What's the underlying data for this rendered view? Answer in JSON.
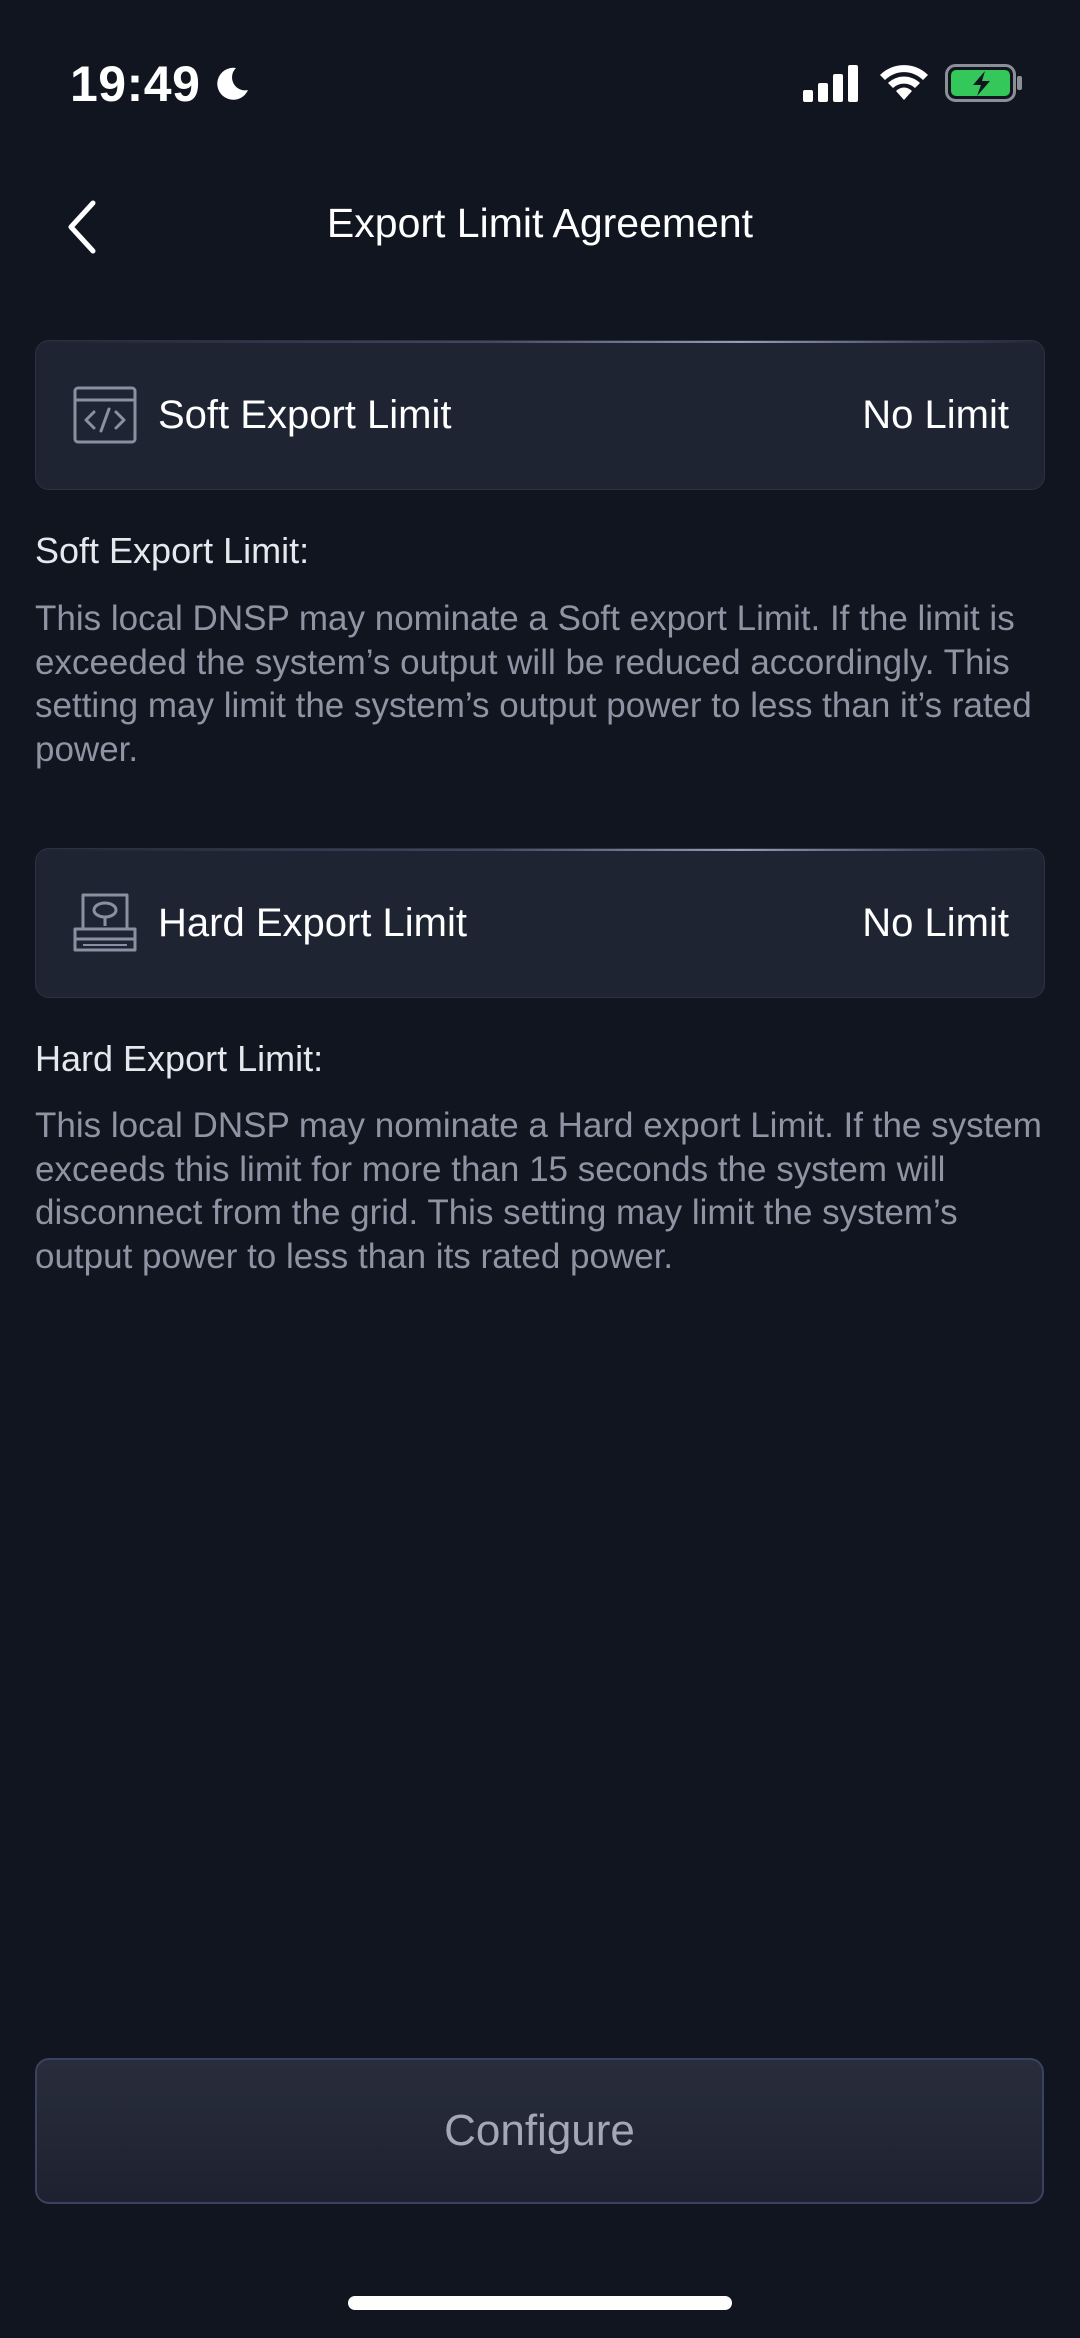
{
  "status_bar": {
    "time": "19:49",
    "moon_icon": "moon-icon",
    "signal_icon": "cellular-signal-icon",
    "wifi_icon": "wifi-icon",
    "battery_icon": "battery-charging-icon",
    "battery_color": "#34c759"
  },
  "nav": {
    "back_icon": "chevron-left-icon",
    "title": "Export Limit Agreement"
  },
  "soft": {
    "icon": "code-window-icon",
    "label": "Soft Export Limit",
    "value": "No Limit",
    "heading": "Soft Export Limit:",
    "body": "This local DNSP may nominate a Soft export Limit. If the limit is exceeded the system’s output will be reduced accordingly. This setting may limit the system’s output power to less than it’s rated power."
  },
  "hard": {
    "icon": "hard-drive-icon",
    "label": "Hard Export Limit",
    "value": "No Limit",
    "heading": "Hard Export Limit:",
    "body": "This local DNSP may nominate a Hard export Limit. If the system exceeds this limit for more than 15 seconds the system will disconnect from the grid. This setting may limit the system’s output power to less than its rated power."
  },
  "footer": {
    "configure_label": "Configure"
  },
  "colors": {
    "background": "#11151f",
    "card": "#1f2433",
    "body_text": "#8e94a3",
    "button_text": "#a3a8b5"
  }
}
